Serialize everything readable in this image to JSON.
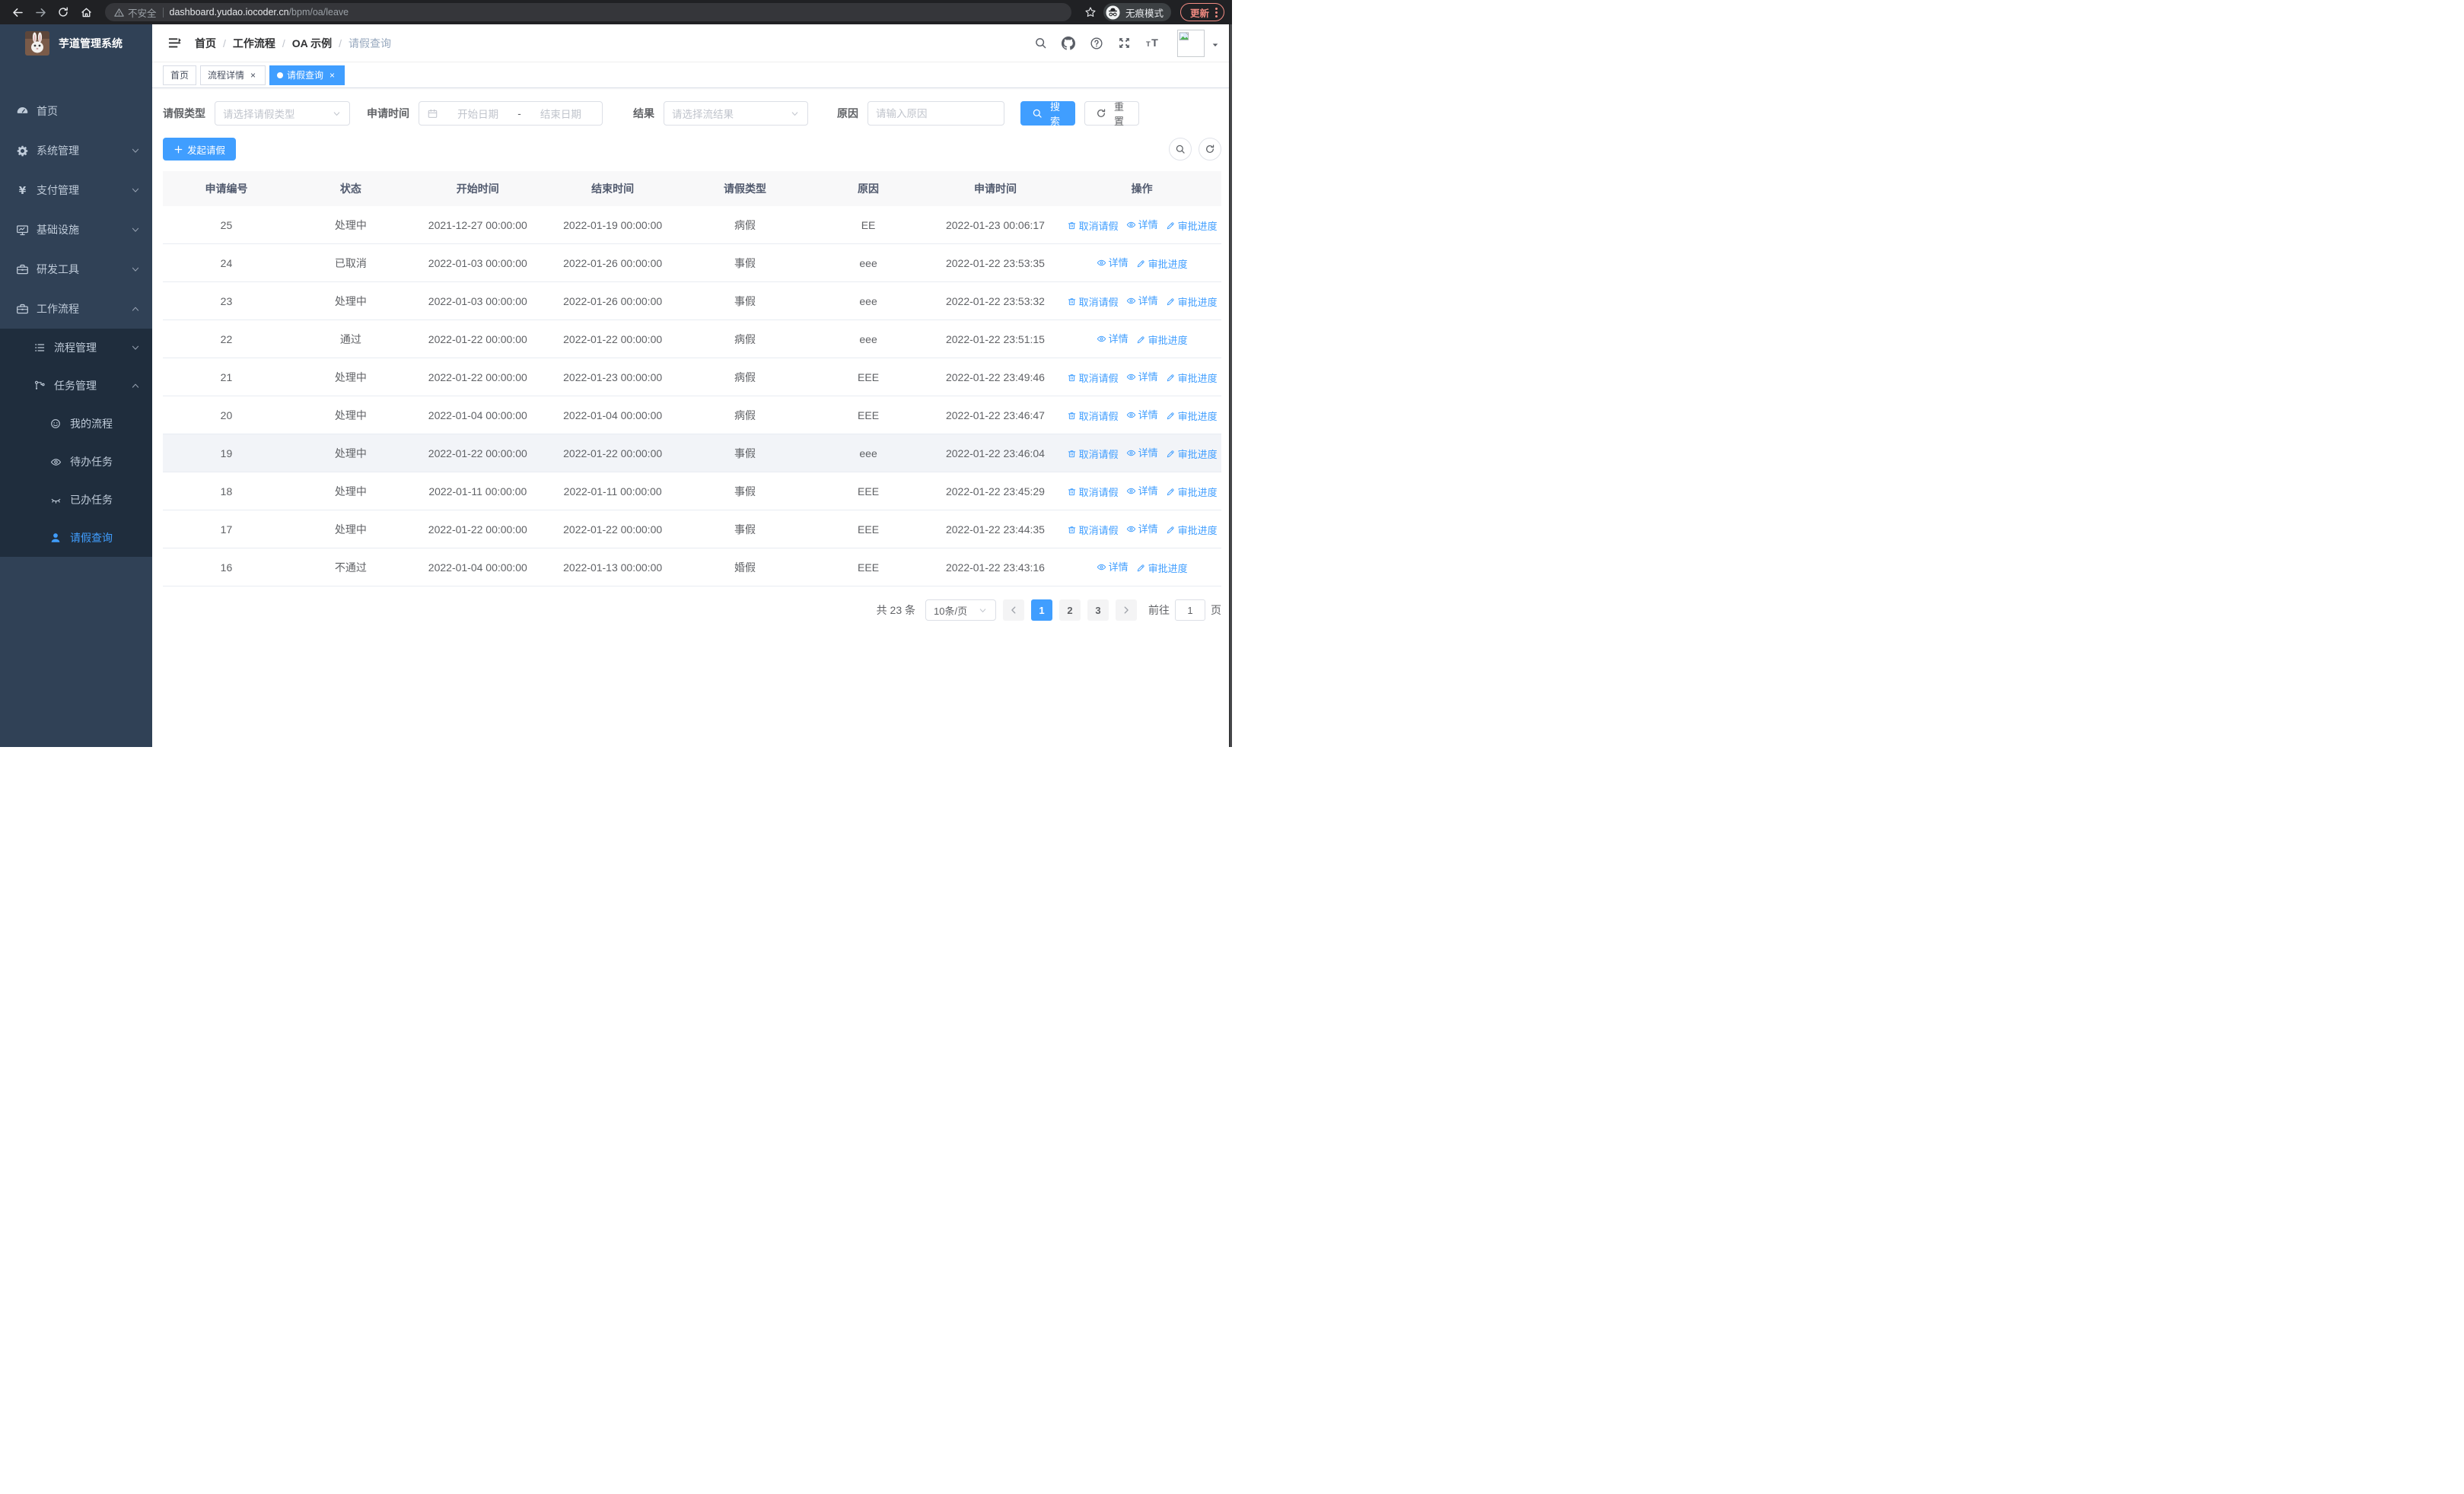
{
  "browser": {
    "security_label": "不安全",
    "url_host": "dashboard.yudao.iocoder.cn",
    "url_path": "/bpm/oa/leave",
    "incognito_label": "无痕模式",
    "update_label": "更新"
  },
  "sidebar": {
    "title": "芋道管理系统",
    "items": [
      {
        "label": "首页",
        "icon": "gauge-icon",
        "level": 1,
        "arrow": null,
        "active": false,
        "dark": false
      },
      {
        "label": "系统管理",
        "icon": "gear-icon",
        "level": 1,
        "arrow": "down",
        "active": false,
        "dark": false
      },
      {
        "label": "支付管理",
        "icon": "yen-icon",
        "level": 1,
        "arrow": "down",
        "active": false,
        "dark": false
      },
      {
        "label": "基础设施",
        "icon": "monitor-icon",
        "level": 1,
        "arrow": "down",
        "active": false,
        "dark": false
      },
      {
        "label": "研发工具",
        "icon": "toolbox-icon",
        "level": 1,
        "arrow": "down",
        "active": false,
        "dark": false
      },
      {
        "label": "工作流程",
        "icon": "briefcase-icon",
        "level": 1,
        "arrow": "up",
        "active": false,
        "dark": false
      },
      {
        "label": "流程管理",
        "icon": "list-tree-icon",
        "level": 2,
        "arrow": "down",
        "active": false,
        "dark": true
      },
      {
        "label": "任务管理",
        "icon": "flow-icon",
        "level": 2,
        "arrow": "up",
        "active": false,
        "dark": true
      },
      {
        "label": "我的流程",
        "icon": "robot-icon",
        "level": 3,
        "arrow": null,
        "active": false,
        "dark": true
      },
      {
        "label": "待办任务",
        "icon": "eye-icon",
        "level": 3,
        "arrow": null,
        "active": false,
        "dark": true
      },
      {
        "label": "已办任务",
        "icon": "eye-closed-icon",
        "level": 3,
        "arrow": null,
        "active": false,
        "dark": true
      },
      {
        "label": "请假查询",
        "icon": "user-icon",
        "level": 3,
        "arrow": null,
        "active": true,
        "dark": true
      }
    ]
  },
  "header": {
    "breadcrumb": [
      {
        "label": "首页",
        "current": false
      },
      {
        "label": "工作流程",
        "current": false
      },
      {
        "label": "OA 示例",
        "current": false
      },
      {
        "label": "请假查询",
        "current": true
      }
    ]
  },
  "tabs": [
    {
      "label": "首页",
      "closable": false,
      "active": false
    },
    {
      "label": "流程详情",
      "closable": true,
      "active": false
    },
    {
      "label": "请假查询",
      "closable": true,
      "active": true
    }
  ],
  "filters": {
    "type_label": "请假类型",
    "type_placeholder": "请选择请假类型",
    "time_label": "申请时间",
    "time_start_placeholder": "开始日期",
    "time_separator": "-",
    "time_end_placeholder": "结束日期",
    "result_label": "结果",
    "result_placeholder": "请选择流结果",
    "reason_label": "原因",
    "reason_placeholder": "请输入原因",
    "search_label": "搜索",
    "reset_label": "重置"
  },
  "toolbar": {
    "create_label": "发起请假"
  },
  "table": {
    "columns": [
      "申请编号",
      "状态",
      "开始时间",
      "结束时间",
      "请假类型",
      "原因",
      "申请时间",
      "操作"
    ],
    "col_widths": [
      "12%",
      "11.5%",
      "12.5%",
      "13%",
      "12%",
      "11.3%",
      "12.7%",
      "15%"
    ],
    "action_labels": {
      "cancel": "取消请假",
      "detail": "详情",
      "progress": "审批进度"
    },
    "rows": [
      {
        "id": "25",
        "status": "处理中",
        "start": "2021-12-27 00:00:00",
        "end": "2022-01-19 00:00:00",
        "type": "病假",
        "reason": "EE",
        "apply": "2022-01-23 00:06:17",
        "actions": [
          "cancel",
          "detail",
          "progress"
        ],
        "highlight": false
      },
      {
        "id": "24",
        "status": "已取消",
        "start": "2022-01-03 00:00:00",
        "end": "2022-01-26 00:00:00",
        "type": "事假",
        "reason": "eee",
        "apply": "2022-01-22 23:53:35",
        "actions": [
          "detail",
          "progress"
        ],
        "highlight": false
      },
      {
        "id": "23",
        "status": "处理中",
        "start": "2022-01-03 00:00:00",
        "end": "2022-01-26 00:00:00",
        "type": "事假",
        "reason": "eee",
        "apply": "2022-01-22 23:53:32",
        "actions": [
          "cancel",
          "detail",
          "progress"
        ],
        "highlight": false
      },
      {
        "id": "22",
        "status": "通过",
        "start": "2022-01-22 00:00:00",
        "end": "2022-01-22 00:00:00",
        "type": "病假",
        "reason": "eee",
        "apply": "2022-01-22 23:51:15",
        "actions": [
          "detail",
          "progress"
        ],
        "highlight": false
      },
      {
        "id": "21",
        "status": "处理中",
        "start": "2022-01-22 00:00:00",
        "end": "2022-01-23 00:00:00",
        "type": "病假",
        "reason": "EEE",
        "apply": "2022-01-22 23:49:46",
        "actions": [
          "cancel",
          "detail",
          "progress"
        ],
        "highlight": false
      },
      {
        "id": "20",
        "status": "处理中",
        "start": "2022-01-04 00:00:00",
        "end": "2022-01-04 00:00:00",
        "type": "病假",
        "reason": "EEE",
        "apply": "2022-01-22 23:46:47",
        "actions": [
          "cancel",
          "detail",
          "progress"
        ],
        "highlight": false
      },
      {
        "id": "19",
        "status": "处理中",
        "start": "2022-01-22 00:00:00",
        "end": "2022-01-22 00:00:00",
        "type": "事假",
        "reason": "eee",
        "apply": "2022-01-22 23:46:04",
        "actions": [
          "cancel",
          "detail",
          "progress"
        ],
        "highlight": true
      },
      {
        "id": "18",
        "status": "处理中",
        "start": "2022-01-11 00:00:00",
        "end": "2022-01-11 00:00:00",
        "type": "事假",
        "reason": "EEE",
        "apply": "2022-01-22 23:45:29",
        "actions": [
          "cancel",
          "detail",
          "progress"
        ],
        "highlight": false
      },
      {
        "id": "17",
        "status": "处理中",
        "start": "2022-01-22 00:00:00",
        "end": "2022-01-22 00:00:00",
        "type": "事假",
        "reason": "EEE",
        "apply": "2022-01-22 23:44:35",
        "actions": [
          "cancel",
          "detail",
          "progress"
        ],
        "highlight": false
      },
      {
        "id": "16",
        "status": "不通过",
        "start": "2022-01-04 00:00:00",
        "end": "2022-01-13 00:00:00",
        "type": "婚假",
        "reason": "EEE",
        "apply": "2022-01-22 23:43:16",
        "actions": [
          "detail",
          "progress"
        ],
        "highlight": false
      }
    ]
  },
  "pagination": {
    "total_label": "共 23 条",
    "page_size": "10条/页",
    "pages": [
      "1",
      "2",
      "3"
    ],
    "active_page": "1",
    "jump_prefix": "前往",
    "jump_value": "1",
    "jump_suffix": "页"
  },
  "colors": {
    "accent": "#409eff",
    "sidebar_bg": "#304156",
    "submenu_bg": "#1f2d3d",
    "update_accent": "#f28b82"
  }
}
